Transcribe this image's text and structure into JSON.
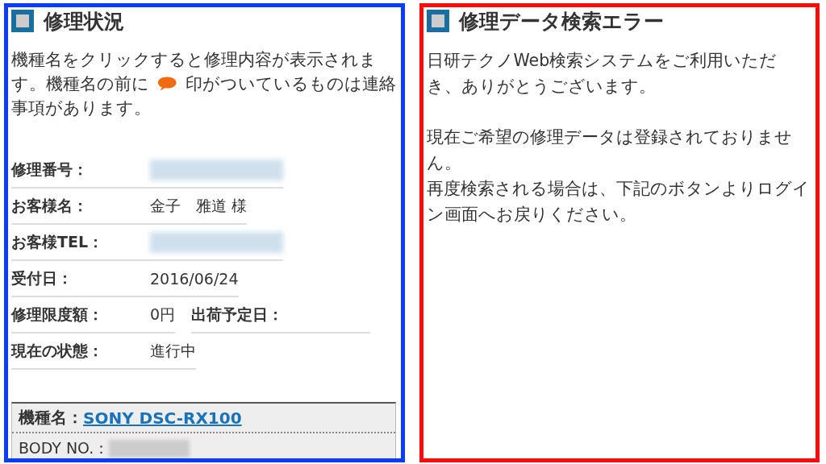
{
  "panels": [
    {
      "kind": "status",
      "color": "#0a3cff",
      "title": "修理状況",
      "intro_lines": [
        [
          {
            "kind": "text",
            "text": "機種名をクリックすると修理内容が表示されま"
          }
        ],
        [
          {
            "kind": "text",
            "text": "す。機種名の前に"
          },
          {
            "kind": "icon"
          },
          {
            "kind": "text",
            "text": "印がついているものは連絡"
          }
        ],
        [
          {
            "kind": "text",
            "text": "事項があります。"
          }
        ]
      ],
      "fields": [
        {
          "items": [
            {
              "label": "修理番号：",
              "kind": "redacted"
            }
          ]
        },
        {
          "items": [
            {
              "label": "お客様名：",
              "kind": "text",
              "value": "金子　雅道 様"
            }
          ]
        },
        {
          "items": [
            {
              "label": "お客様TEL：",
              "kind": "redacted"
            }
          ]
        },
        {
          "items": [
            {
              "label": "受付日：",
              "kind": "text",
              "value": "2016/06/24"
            }
          ]
        },
        {
          "items": [
            {
              "label": "修理限度額：",
              "kind": "text",
              "value": "0円"
            },
            {
              "label": "出荷予定日：",
              "kind": "empty"
            }
          ]
        },
        {
          "items": [
            {
              "label": "現在の状態：",
              "kind": "text",
              "value": "進行中"
            }
          ]
        }
      ],
      "model": {
        "label": "機種名：",
        "name": "SONY DSC-RX100",
        "body_label": "BODY NO.："
      }
    },
    {
      "kind": "error",
      "color": "#ff0a0a",
      "title": "修理データ検索エラー",
      "paragraphs": [
        [
          "日研テクノWeb検索システムをご利用いただき、ありがとうございます。"
        ],
        [
          "現在ご希望の修理データは登録されておりません。",
          "再度検索される場合は、下記のボタンよりログイン画面へお戻りください。"
        ]
      ]
    }
  ]
}
